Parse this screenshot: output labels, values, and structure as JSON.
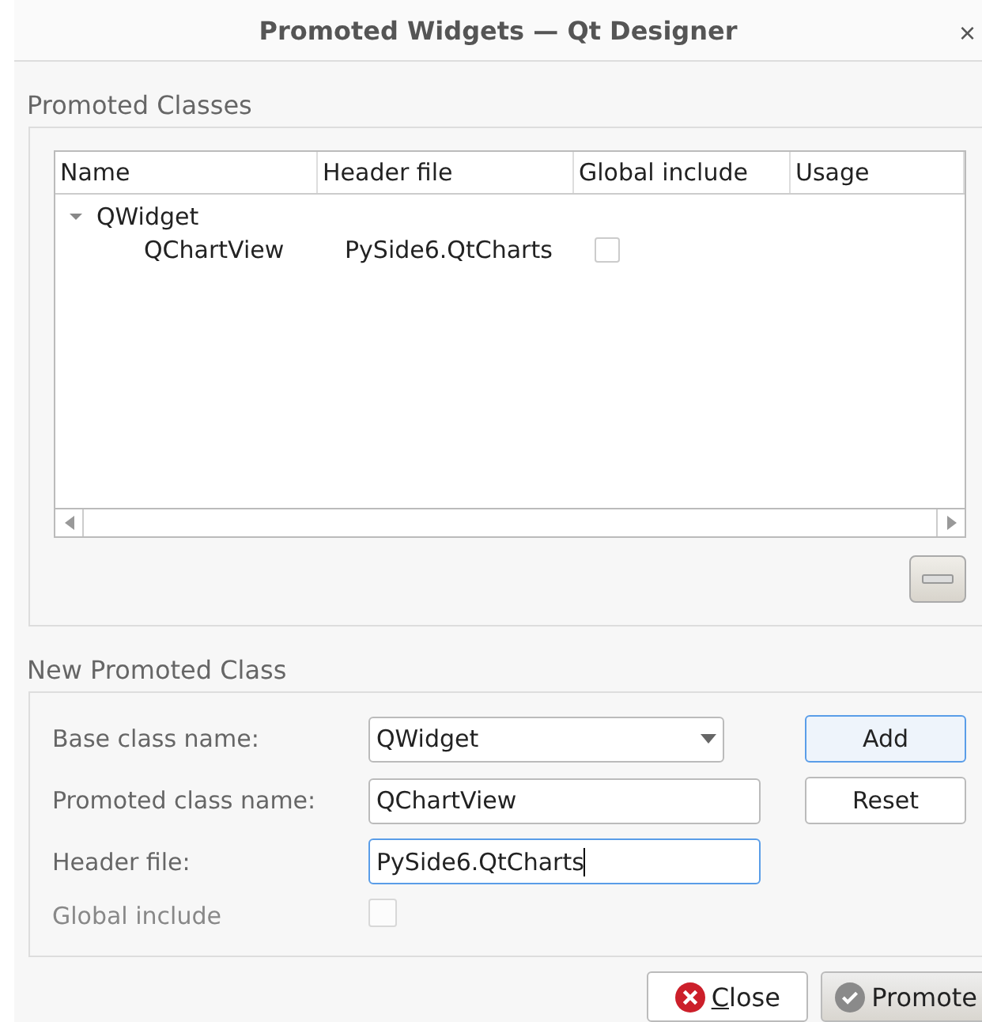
{
  "window": {
    "title": "Promoted Widgets — Qt Designer",
    "close": "×"
  },
  "promoted_classes": {
    "title": "Promoted Classes",
    "columns": [
      "Name",
      "Header file",
      "Global include",
      "Usage"
    ],
    "tree": [
      {
        "name": "QWidget",
        "expanded": true,
        "children": [
          {
            "name": "QChartView",
            "header": "PySide6.QtCharts",
            "global_include": false
          }
        ]
      }
    ]
  },
  "new_promoted_class": {
    "title": "New Promoted Class",
    "fields": [
      {
        "kind": "combo",
        "label": "Base class name:",
        "value": "QWidget",
        "focused": false
      },
      {
        "kind": "text",
        "label": "Promoted class name:",
        "value": "QChartView",
        "focused": false
      },
      {
        "kind": "text",
        "label": "Header file:",
        "value": "PySide6.QtCharts",
        "focused": true
      },
      {
        "kind": "checkbox",
        "label": "Global include",
        "checked": false,
        "disabled": true
      }
    ],
    "buttons": [
      {
        "label": "Add",
        "default": true
      },
      {
        "label": "Reset",
        "default": false
      }
    ]
  },
  "footer_buttons": [
    {
      "label": "Close",
      "kind": "close"
    },
    {
      "label": "Promote",
      "kind": "promote"
    }
  ]
}
